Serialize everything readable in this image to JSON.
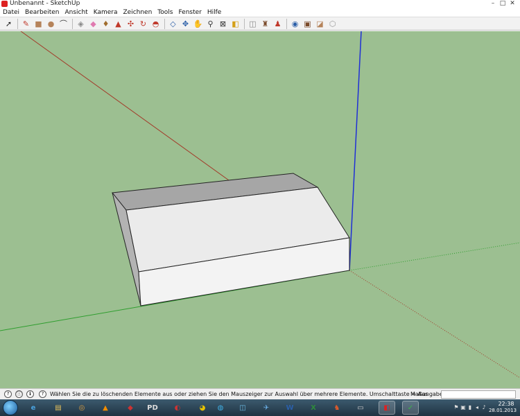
{
  "window": {
    "title": "Unbenannt - SketchUp"
  },
  "window_buttons": {
    "minimize": "–",
    "maximize": "□",
    "close": "✕"
  },
  "menu": [
    "Datei",
    "Bearbeiten",
    "Ansicht",
    "Kamera",
    "Zeichnen",
    "Tools",
    "Fenster",
    "Hilfe"
  ],
  "toolbar": {
    "tools": [
      {
        "name": "select-tool-icon",
        "glyph": "➚",
        "color": "#222"
      },
      {
        "name": "pencil-line-tool-icon",
        "glyph": "✎",
        "color": "#c0392b"
      },
      {
        "name": "rectangle-tool-icon",
        "glyph": "■",
        "color": "#b5835a"
      },
      {
        "name": "circle-tool-icon",
        "glyph": "●",
        "color": "#b5835a"
      },
      {
        "name": "arc-tool-icon",
        "glyph": "⌒",
        "color": "#333"
      },
      {
        "name": "make-component-icon",
        "glyph": "◈",
        "color": "#888"
      },
      {
        "name": "eraser-tool-icon",
        "glyph": "◆",
        "color": "#e07ab0"
      },
      {
        "name": "paint-bucket-icon",
        "glyph": "♦",
        "color": "#a06d2e"
      },
      {
        "name": "push-pull-tool-icon",
        "glyph": "▲",
        "color": "#c0392b"
      },
      {
        "name": "move-tool-icon",
        "glyph": "✣",
        "color": "#c0392b"
      },
      {
        "name": "rotate-tool-icon",
        "glyph": "↻",
        "color": "#c0392b"
      },
      {
        "name": "follow-me-tool-icon",
        "glyph": "◓",
        "color": "#c0392b"
      },
      {
        "name": "offset-tool-icon",
        "glyph": "◇",
        "color": "#2b5fa8"
      },
      {
        "name": "orbit-tool-icon",
        "glyph": "✥",
        "color": "#2b5fa8"
      },
      {
        "name": "pan-tool-icon",
        "glyph": "✋",
        "color": "#555"
      },
      {
        "name": "zoom-tool-icon",
        "glyph": "⚲",
        "color": "#333"
      },
      {
        "name": "zoom-extents-icon",
        "glyph": "⊠",
        "color": "#333"
      },
      {
        "name": "tape-measure-icon",
        "glyph": "◧",
        "color": "#d4a017"
      },
      {
        "name": "protractor-icon",
        "glyph": "◫",
        "color": "#888"
      },
      {
        "name": "walk-tool-icon",
        "glyph": "♜",
        "color": "#7a4a2a"
      },
      {
        "name": "position-camera-icon",
        "glyph": "♟",
        "color": "#c0392b"
      },
      {
        "name": "look-around-icon",
        "glyph": "◉",
        "color": "#2b5fa8"
      },
      {
        "name": "get-models-icon",
        "glyph": "▣",
        "color": "#7a4a2a"
      },
      {
        "name": "share-model-icon",
        "glyph": "◪",
        "color": "#b5835a"
      },
      {
        "name": "component-browser-icon",
        "glyph": "⬡",
        "color": "#999"
      }
    ]
  },
  "status": {
    "message": "Wählen Sie die zu löschenden Elemente aus oder ziehen Sie den Mauszeiger zur Auswahl über mehrere Elemente. Umschalttaste = Aus",
    "measurements_label": "Maßangaben",
    "measurements_value": "",
    "icons": [
      "info-icon",
      "geo-location-icon",
      "credits-icon"
    ],
    "icon_glyphs": [
      "?",
      "ⓘ",
      "ℹ"
    ]
  },
  "colors": {
    "viewport_background": "#9cbf91",
    "axis_red": "#a33b2a",
    "axis_green": "#2e9e2e",
    "axis_blue": "#1f2fd6",
    "face_front": "#f3f3f3",
    "face_roof": "#ebebeb",
    "face_top_slab": "#a6a6a6",
    "face_side": "#b3b3b3"
  },
  "taskbar": {
    "apps": [
      {
        "name": "ie-taskbar-icon",
        "glyph": "e",
        "color": "#4aa3df"
      },
      {
        "name": "explorer-taskbar-icon",
        "glyph": "▤",
        "color": "#e8c35a"
      },
      {
        "name": "app-taskbar-icon-3",
        "glyph": "◎",
        "color": "#e0a040"
      },
      {
        "name": "vlc-taskbar-icon",
        "glyph": "▲",
        "color": "#f08c00"
      },
      {
        "name": "app-taskbar-icon-5",
        "glyph": "◆",
        "color": "#c33"
      },
      {
        "name": "pd-taskbar-icon",
        "glyph": "PD",
        "color": "#ddd"
      },
      {
        "name": "app-taskbar-icon-7",
        "glyph": "◐",
        "color": "#c33"
      },
      {
        "name": "app-taskbar-icon-8",
        "glyph": "◕",
        "color": "#e5c100"
      },
      {
        "name": "app-taskbar-icon-9",
        "glyph": "◍",
        "color": "#3fb0e6"
      },
      {
        "name": "app-taskbar-icon-10",
        "glyph": "◫",
        "color": "#6cbbe5"
      },
      {
        "name": "app-taskbar-icon-11",
        "glyph": "✈",
        "color": "#6bb1e8"
      },
      {
        "name": "word-taskbar-icon",
        "glyph": "W",
        "color": "#2b5fa8"
      },
      {
        "name": "excel-taskbar-icon",
        "glyph": "X",
        "color": "#2e8b3c"
      },
      {
        "name": "app-taskbar-icon-14",
        "glyph": "♞",
        "color": "#e05a2a"
      },
      {
        "name": "cmd-taskbar-icon",
        "glyph": "▭",
        "color": "#ccc"
      },
      {
        "name": "sketchup-taskbar-icon",
        "glyph": "◧",
        "color": "#d22"
      },
      {
        "name": "app-taskbar-icon-17",
        "glyph": "✓",
        "color": "#3bb54a"
      }
    ],
    "clock_time": "22:38",
    "clock_date": "28.01.2013",
    "tray_glyphs": [
      "⚑",
      "▣",
      "▮",
      "◂",
      "♪"
    ]
  }
}
